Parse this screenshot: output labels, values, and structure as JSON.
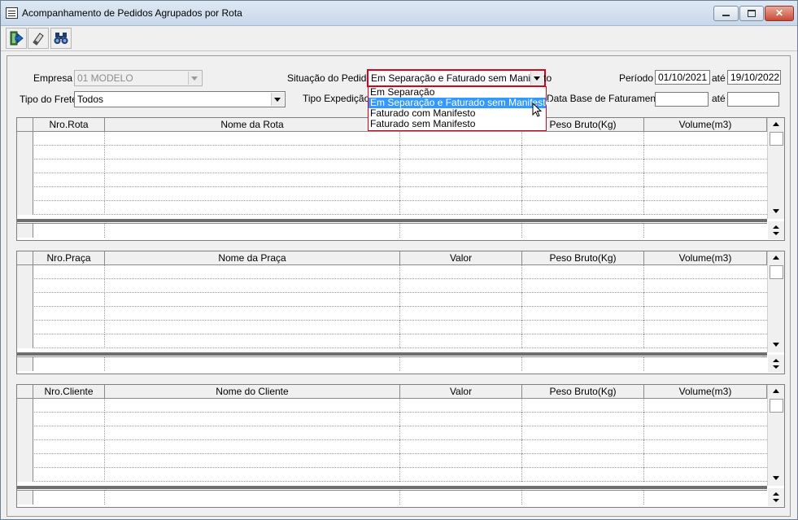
{
  "window": {
    "title": "Acompanhamento de Pedidos Agrupados por Rota",
    "controls": [
      "minimize",
      "maximize",
      "close"
    ],
    "close_label": "✕"
  },
  "toolbar": {
    "icons": [
      "exit-icon",
      "eraser-icon",
      "binoculars-icon"
    ]
  },
  "filters": {
    "empresa_label": "Empresa",
    "empresa_value": "01 MODELO",
    "tipo_frete_label": "Tipo do Frete",
    "tipo_frete_value": "Todos",
    "situacao_label": "Situação do Pedido",
    "situacao_value": "Em Separação e Faturado sem Manifesto",
    "tipo_expedicao_label": "Tipo Expedição",
    "periodo_label": "Período",
    "periodo_from": "01/10/2021",
    "periodo_ate": "até",
    "periodo_to": "19/10/2022",
    "data_base_label": "Data Base de Faturamento",
    "data_base_ate": "até",
    "data_base_from": "",
    "data_base_to": ""
  },
  "situacao_options": [
    {
      "label": "Em Separação",
      "selected": false
    },
    {
      "label": "Em Separação e Faturado sem Manifesto",
      "selected": true
    },
    {
      "label": "Faturado com Manifesto",
      "selected": false
    },
    {
      "label": "Faturado sem Manifesto",
      "selected": false
    }
  ],
  "grids": [
    {
      "columns": [
        "Nro.Rota",
        "Nome da Rota",
        "",
        "Peso Bruto(Kg)",
        "Volume(m3)"
      ],
      "rows": 6
    },
    {
      "columns": [
        "Nro.Praça",
        "Nome da Praça",
        "Valor",
        "Peso Bruto(Kg)",
        "Volume(m3)"
      ],
      "rows": 6
    },
    {
      "columns": [
        "Nro.Cliente",
        "Nome do Cliente",
        "Valor",
        "Peso Bruto(Kg)",
        "Volume(m3)"
      ],
      "rows": 6
    }
  ],
  "colors": {
    "highlight_border": "#e0001b",
    "selection": "#3399ff"
  }
}
